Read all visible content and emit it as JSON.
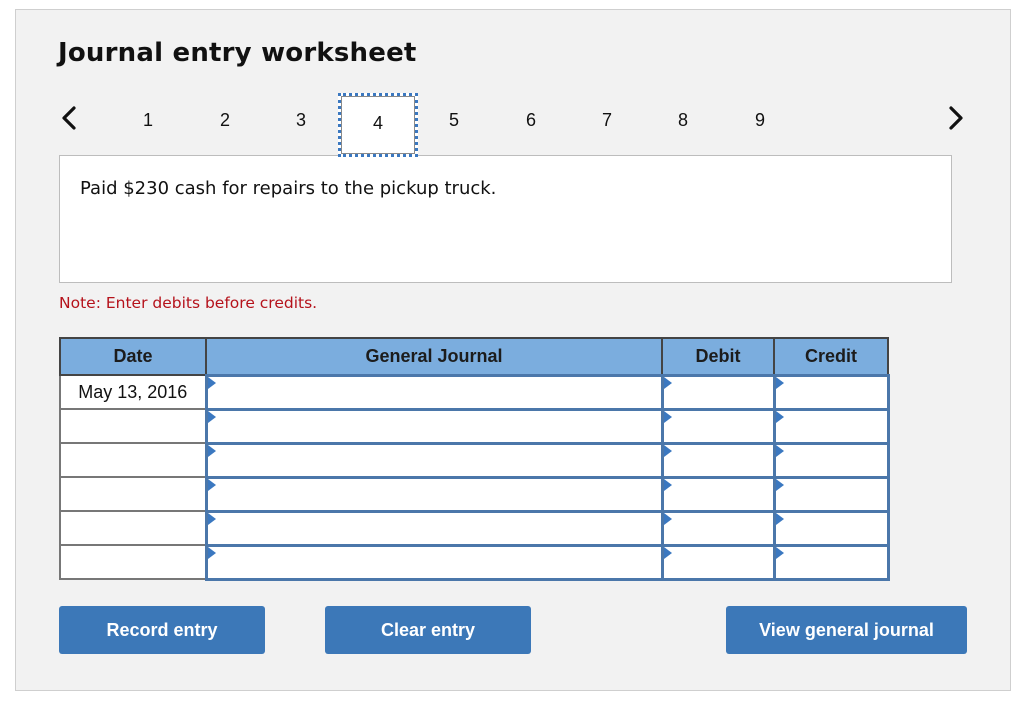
{
  "header": {
    "title": "Journal entry worksheet"
  },
  "nav": {
    "prev_icon": "chevron-left-icon",
    "next_icon": "chevron-right-icon",
    "tabs": [
      {
        "label": "1",
        "active": false
      },
      {
        "label": "2",
        "active": false
      },
      {
        "label": "3",
        "active": false
      },
      {
        "label": "4",
        "active": true
      },
      {
        "label": "5",
        "active": false
      },
      {
        "label": "6",
        "active": false
      },
      {
        "label": "7",
        "active": false
      },
      {
        "label": "8",
        "active": false
      },
      {
        "label": "9",
        "active": false
      }
    ]
  },
  "description": "Paid $230 cash for repairs to the pickup truck.",
  "note": "Note: Enter debits before credits.",
  "table": {
    "headers": [
      "Date",
      "General Journal",
      "Debit",
      "Credit"
    ],
    "rows": [
      {
        "date": "May 13, 2016",
        "account": "",
        "debit": "",
        "credit": ""
      },
      {
        "date": "",
        "account": "",
        "debit": "",
        "credit": ""
      },
      {
        "date": "",
        "account": "",
        "debit": "",
        "credit": ""
      },
      {
        "date": "",
        "account": "",
        "debit": "",
        "credit": ""
      },
      {
        "date": "",
        "account": "",
        "debit": "",
        "credit": ""
      },
      {
        "date": "",
        "account": "",
        "debit": "",
        "credit": ""
      }
    ]
  },
  "buttons": {
    "record": "Record entry",
    "clear": "Clear entry",
    "view": "View general journal"
  },
  "colors": {
    "accent": "#3c78b8",
    "header_bg": "#7badde",
    "note": "#b5121b"
  }
}
